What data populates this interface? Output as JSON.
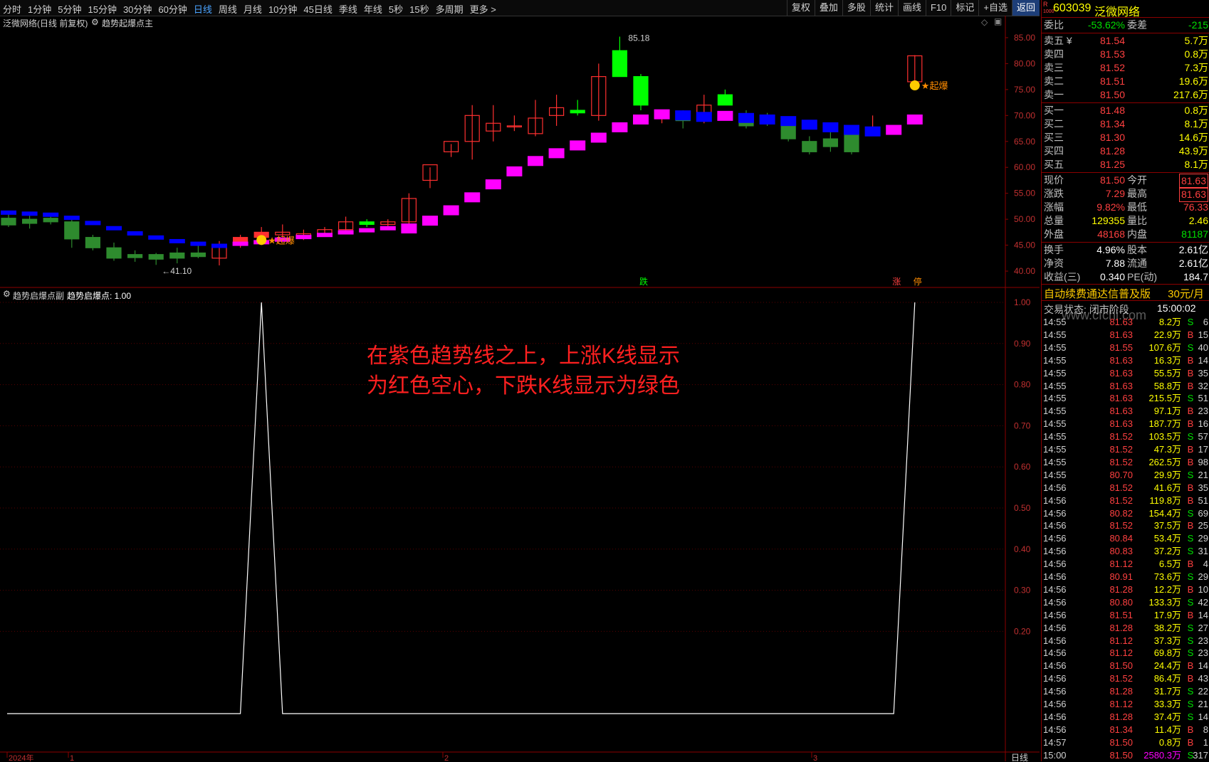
{
  "toolbar": {
    "periods": [
      "分时",
      "1分钟",
      "5分钟",
      "15分钟",
      "30分钟",
      "60分钟",
      "日线",
      "周线",
      "月线",
      "10分钟",
      "45日线",
      "季线",
      "年线",
      "5秒",
      "15秒",
      "多周期",
      "更多 >"
    ],
    "active": "日线",
    "right_buttons": [
      "复权",
      "叠加",
      "多股",
      "统计",
      "画线",
      "F10",
      "标记",
      "+自选",
      "返回"
    ]
  },
  "main_chart": {
    "title": "泛微网络(日线 前复权)",
    "indicator": "趋势起爆点主",
    "y_ticks": [
      "85.00",
      "80.00",
      "75.00",
      "70.00",
      "65.00",
      "60.00",
      "55.00",
      "50.00",
      "45.00",
      "40.00"
    ],
    "high_label": "85.18",
    "low_label": "41.10",
    "signal_text": "★起爆",
    "markers": {
      "die": "跌",
      "zhang": "涨",
      "ting": "停"
    }
  },
  "sub_chart": {
    "title": "趋势启爆点副",
    "indicator_label": "趋势启爆点: 1.00",
    "y_ticks": [
      "1.00",
      "0.90",
      "0.80",
      "0.70",
      "0.60",
      "0.50",
      "0.40",
      "0.30",
      "0.20"
    ],
    "x_labels": [
      "2024年",
      "1",
      "2",
      "3"
    ],
    "period_label": "日线"
  },
  "annotation": {
    "line1": "在紫色趋势线之上，上涨K线显示",
    "line2": "为红色空心，下跌K线显示为绿色"
  },
  "stock": {
    "code": "603039",
    "name": "泛微网络",
    "tag": "R"
  },
  "weibi": {
    "label": "委比",
    "value": "-53.62%",
    "label2": "委差",
    "value2": "-215"
  },
  "sell": [
    {
      "label": "卖五 ¥",
      "price": "81.54",
      "vol": "5.7万"
    },
    {
      "label": "卖四",
      "price": "81.53",
      "vol": "0.8万"
    },
    {
      "label": "卖三",
      "price": "81.52",
      "vol": "7.3万"
    },
    {
      "label": "卖二",
      "price": "81.51",
      "vol": "19.6万"
    },
    {
      "label": "卖一",
      "price": "81.50",
      "vol": "217.6万"
    }
  ],
  "buy": [
    {
      "label": "买一",
      "price": "81.48",
      "vol": "0.8万"
    },
    {
      "label": "买二",
      "price": "81.34",
      "vol": "8.1万"
    },
    {
      "label": "买三",
      "price": "81.30",
      "vol": "14.6万"
    },
    {
      "label": "买四",
      "price": "81.28",
      "vol": "43.9万"
    },
    {
      "label": "买五",
      "price": "81.25",
      "vol": "8.1万"
    }
  ],
  "quote": [
    {
      "l": "现价",
      "v": "81.50",
      "l2": "今开",
      "v2": "81.63"
    },
    {
      "l": "涨跌",
      "v": "7.29",
      "l2": "最高",
      "v2": "81.63"
    },
    {
      "l": "涨幅",
      "v": "9.82%",
      "l2": "最低",
      "v2": "76.33"
    },
    {
      "l": "总量",
      "v": "129355",
      "l2": "量比",
      "v2": "2.46"
    },
    {
      "l": "外盘",
      "v": "48168",
      "l2": "内盘",
      "v2": "81187"
    }
  ],
  "fund": [
    {
      "l": "换手",
      "v": "4.96%",
      "l2": "股本",
      "v2": "2.61亿"
    },
    {
      "l": "净资",
      "v": "7.88",
      "l2": "流通",
      "v2": "2.61亿"
    },
    {
      "l": "收益(三)",
      "v": "0.340",
      "l2": "PE(动)",
      "v2": "184.7"
    }
  ],
  "banner": {
    "text": "自动续费通达信普及版",
    "price": "30元/月"
  },
  "trade_status": {
    "label": "交易状态: 闭市阶段",
    "time": "15:00:02"
  },
  "watermark": "www.cfchi.com",
  "ticks": [
    [
      "14:55",
      "81.63",
      "8.2万",
      "S",
      "6"
    ],
    [
      "14:55",
      "81.63",
      "22.9万",
      "B",
      "15"
    ],
    [
      "14:55",
      "81.55",
      "107.6万",
      "S",
      "40"
    ],
    [
      "14:55",
      "81.63",
      "16.3万",
      "B",
      "14"
    ],
    [
      "14:55",
      "81.63",
      "55.5万",
      "B",
      "35"
    ],
    [
      "14:55",
      "81.63",
      "58.8万",
      "B",
      "32"
    ],
    [
      "14:55",
      "81.63",
      "215.5万",
      "S",
      "51"
    ],
    [
      "14:55",
      "81.63",
      "97.1万",
      "B",
      "23"
    ],
    [
      "14:55",
      "81.63",
      "187.7万",
      "B",
      "16"
    ],
    [
      "14:55",
      "81.52",
      "103.5万",
      "S",
      "57"
    ],
    [
      "14:55",
      "81.52",
      "47.3万",
      "B",
      "17"
    ],
    [
      "14:55",
      "81.52",
      "262.5万",
      "B",
      "98"
    ],
    [
      "14:55",
      "80.70",
      "29.9万",
      "S",
      "21"
    ],
    [
      "14:56",
      "81.52",
      "41.6万",
      "B",
      "35"
    ],
    [
      "14:56",
      "81.52",
      "119.8万",
      "B",
      "51"
    ],
    [
      "14:56",
      "80.82",
      "154.4万",
      "S",
      "69"
    ],
    [
      "14:56",
      "81.52",
      "37.5万",
      "B",
      "25"
    ],
    [
      "14:56",
      "80.84",
      "53.4万",
      "S",
      "29"
    ],
    [
      "14:56",
      "80.83",
      "37.2万",
      "S",
      "31"
    ],
    [
      "14:56",
      "81.12",
      "6.5万",
      "B",
      "4"
    ],
    [
      "14:56",
      "80.91",
      "73.6万",
      "S",
      "29"
    ],
    [
      "14:56",
      "81.28",
      "12.2万",
      "B",
      "10"
    ],
    [
      "14:56",
      "80.80",
      "133.3万",
      "S",
      "42"
    ],
    [
      "14:56",
      "81.51",
      "17.9万",
      "B",
      "14"
    ],
    [
      "14:56",
      "81.28",
      "38.2万",
      "S",
      "27"
    ],
    [
      "14:56",
      "81.12",
      "37.3万",
      "S",
      "23"
    ],
    [
      "14:56",
      "81.12",
      "69.8万",
      "S",
      "23"
    ],
    [
      "14:56",
      "81.50",
      "24.4万",
      "B",
      "14"
    ],
    [
      "14:56",
      "81.52",
      "86.4万",
      "B",
      "43"
    ],
    [
      "14:56",
      "81.28",
      "31.7万",
      "S",
      "22"
    ],
    [
      "14:56",
      "81.12",
      "33.3万",
      "S",
      "21"
    ],
    [
      "14:56",
      "81.28",
      "37.4万",
      "S",
      "14"
    ],
    [
      "14:56",
      "81.34",
      "11.4万",
      "B",
      "8"
    ],
    [
      "14:57",
      "81.50",
      "0.8万",
      "B",
      "1"
    ],
    [
      "15:00",
      "81.50",
      "2580.3万",
      "S",
      "317"
    ]
  ],
  "colors": {
    "up": "#ff3030",
    "down": "#2e8b2e",
    "trend_up": "#ff00ff",
    "trend_down": "#0000ff",
    "bright_green": "#00ff00"
  },
  "candles": [
    {
      "o": 48.9,
      "h": 51.6,
      "l": 48.5,
      "c": 50.2,
      "t": 51.0
    },
    {
      "o": 50.0,
      "h": 51.0,
      "l": 48.2,
      "c": 49.2,
      "t": 50.8
    },
    {
      "o": 50.2,
      "h": 51.0,
      "l": 49.0,
      "c": 49.5,
      "t": 50.6
    },
    {
      "o": 49.5,
      "h": 50.0,
      "l": 44.5,
      "c": 46.2,
      "t": 50.0
    },
    {
      "o": 46.5,
      "h": 47.0,
      "l": 44.0,
      "c": 44.5,
      "t": 49.0
    },
    {
      "o": 44.5,
      "h": 45.5,
      "l": 42.0,
      "c": 42.5,
      "t": 48.0
    },
    {
      "o": 42.6,
      "h": 44.0,
      "l": 41.8,
      "c": 43.2,
      "t": 47.0
    },
    {
      "o": 43.2,
      "h": 43.5,
      "l": 41.2,
      "c": 42.3,
      "t": 46.2
    },
    {
      "o": 42.5,
      "h": 44.5,
      "l": 41.5,
      "c": 43.5,
      "t": 45.5
    },
    {
      "o": 43.5,
      "h": 45.0,
      "l": 42.5,
      "c": 42.8,
      "t": 45.0
    },
    {
      "o": 42.5,
      "h": 45.8,
      "l": 41.1,
      "c": 45.0,
      "t": 44.6
    },
    {
      "o": 45.0,
      "h": 47.0,
      "l": 44.5,
      "c": 46.5,
      "t": 45.0
    },
    {
      "o": 46.5,
      "h": 48.5,
      "l": 46.0,
      "c": 47.5,
      "t": 45.3
    },
    {
      "o": 47.0,
      "h": 49.0,
      "l": 46.5,
      "c": 47.5,
      "t": 45.8
    },
    {
      "o": 46.5,
      "h": 48.0,
      "l": 46.0,
      "c": 47.2,
      "t": 46.3
    },
    {
      "o": 47.2,
      "h": 48.5,
      "l": 46.8,
      "c": 48.0,
      "t": 46.7
    },
    {
      "o": 48.0,
      "h": 50.5,
      "l": 47.5,
      "c": 49.5,
      "t": 47.2
    },
    {
      "o": 49.5,
      "h": 50.0,
      "l": 48.5,
      "c": 49.0,
      "t": 47.6
    },
    {
      "o": 49.0,
      "h": 50.0,
      "l": 48.5,
      "c": 49.5,
      "t": 48.0
    },
    {
      "o": 49.5,
      "h": 55.0,
      "l": 49.0,
      "c": 54.0,
      "t": 48.5
    },
    {
      "o": 57.5,
      "h": 60.0,
      "l": 56.0,
      "c": 60.5,
      "t": 50.0
    },
    {
      "o": 63.0,
      "h": 64.5,
      "l": 62.0,
      "c": 65.0,
      "t": 52.0
    },
    {
      "o": 65.0,
      "h": 72.0,
      "l": 61.5,
      "c": 70.0,
      "t": 54.5
    },
    {
      "o": 67.0,
      "h": 72.0,
      "l": 65.0,
      "c": 68.5,
      "t": 57.0
    },
    {
      "o": 68.0,
      "h": 70.0,
      "l": 67.0,
      "c": 68.0,
      "t": 59.5
    },
    {
      "o": 66.5,
      "h": 73.0,
      "l": 66.0,
      "c": 69.5,
      "t": 61.5
    },
    {
      "o": 70.0,
      "h": 74.0,
      "l": 68.0,
      "c": 71.5,
      "t": 63.0
    },
    {
      "o": 71.0,
      "h": 73.0,
      "l": 70.0,
      "c": 70.5,
      "t": 64.5
    },
    {
      "o": 70.0,
      "h": 80.0,
      "l": 69.0,
      "c": 77.5,
      "t": 66.0
    },
    {
      "o": 82.5,
      "h": 85.2,
      "l": 79.0,
      "c": 77.5,
      "t": 68.0
    },
    {
      "o": 77.5,
      "h": 78.0,
      "l": 71.0,
      "c": 72.0,
      "t": 69.5
    },
    {
      "o": 70.0,
      "h": 71.0,
      "l": 68.5,
      "c": 70.5,
      "t": 70.5
    },
    {
      "o": 70.5,
      "h": 71.0,
      "l": 67.5,
      "c": 69.0,
      "t": 70.3
    },
    {
      "o": 69.5,
      "h": 74.0,
      "l": 68.5,
      "c": 72.0,
      "t": 70.0
    },
    {
      "o": 74.0,
      "h": 75.0,
      "l": 72.0,
      "c": 72.0,
      "t": 70.2
    },
    {
      "o": 70.0,
      "h": 71.0,
      "l": 67.5,
      "c": 68.0,
      "t": 69.8
    },
    {
      "o": 70.0,
      "h": 70.5,
      "l": 68.0,
      "c": 68.5,
      "t": 69.5
    },
    {
      "o": 68.5,
      "h": 69.0,
      "l": 65.0,
      "c": 65.5,
      "t": 69.2
    },
    {
      "o": 65.0,
      "h": 66.0,
      "l": 62.5,
      "c": 63.0,
      "t": 68.5
    },
    {
      "o": 64.0,
      "h": 67.0,
      "l": 63.0,
      "c": 65.5,
      "t": 68.0
    },
    {
      "o": 63.0,
      "h": 67.5,
      "l": 62.5,
      "c": 66.5,
      "t": 67.5
    },
    {
      "o": 67.0,
      "h": 70.0,
      "l": 66.0,
      "c": 67.5,
      "t": 67.2
    },
    {
      "o": 67.0,
      "h": 67.0,
      "l": 67.0,
      "c": 67.0,
      "t": 67.5
    },
    {
      "o": 76.5,
      "h": 81.63,
      "l": 76.33,
      "c": 81.5,
      "t": 69.5
    }
  ],
  "sub_values": [
    0,
    0,
    0,
    0,
    0,
    0,
    0,
    0,
    0,
    0,
    0,
    0,
    1,
    0,
    0,
    0,
    0,
    0,
    0,
    0,
    0,
    0,
    0,
    0,
    0,
    0,
    0,
    0,
    0,
    0,
    0,
    0,
    0,
    0,
    0,
    0,
    0,
    0,
    0,
    0,
    0,
    0,
    0,
    1
  ]
}
